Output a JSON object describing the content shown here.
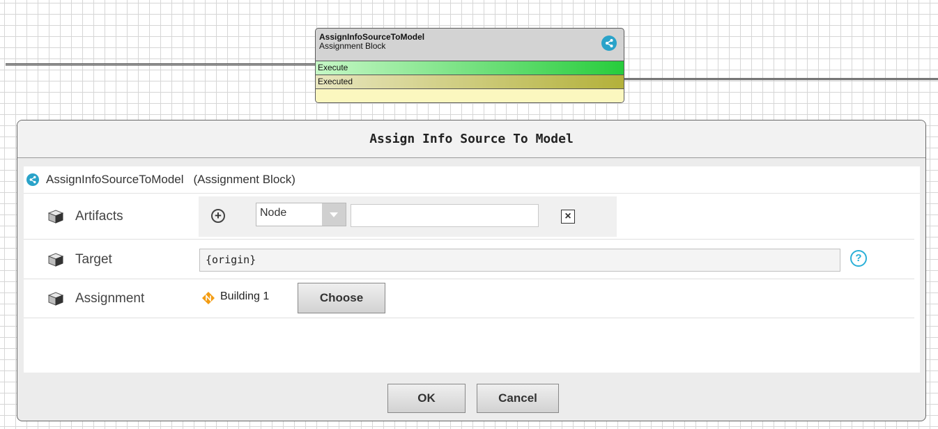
{
  "node": {
    "name": "AssignInfoSourceToModel",
    "type": "Assignment Block",
    "ports": [
      "Execute",
      "Executed"
    ]
  },
  "dialog": {
    "title": "Assign Info Source To Model",
    "block_name": "AssignInfoSourceToModel",
    "block_type": "(Assignment Block)",
    "artifacts": {
      "label": "Artifacts",
      "select_value": "Node",
      "input_value": ""
    },
    "target": {
      "label": "Target",
      "value": "{origin}"
    },
    "assignment": {
      "label": "Assignment",
      "value": "Building 1",
      "choose_label": "Choose"
    },
    "ok_label": "OK",
    "cancel_label": "Cancel"
  },
  "colors": {
    "accent": "#2aa3c9",
    "execute_port": "#27cc3c",
    "executed_port": "#b3b13a",
    "node_icon": "#f39c12"
  },
  "icons": [
    "share-icon",
    "cube-icon",
    "plus-circle-icon",
    "chevron-down-icon",
    "close-icon",
    "help-icon",
    "node-icon"
  ]
}
